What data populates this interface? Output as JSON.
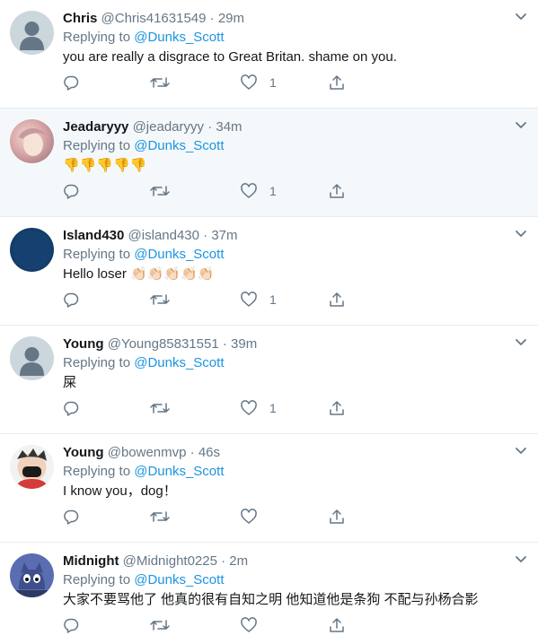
{
  "tweets": [
    {
      "name": "Chris",
      "handle": "@Chris41631549",
      "separator": "·",
      "time": "29m",
      "replying_prefix": "Replying to",
      "mention": "@Dunks_Scott",
      "text": "you are really a disgrace to Great  Britan. shame on you.",
      "like_count": "1",
      "avatar": "default-avatar-icon"
    },
    {
      "name": "Jeadaryyy",
      "handle": "@jeadaryyy",
      "separator": "·",
      "time": "34m",
      "replying_prefix": "Replying to",
      "mention": "@Dunks_Scott",
      "text": "👎👎👎👎👎",
      "like_count": "1",
      "avatar": "photo-avatar"
    },
    {
      "name": "Island430",
      "handle": "@island430",
      "separator": "·",
      "time": "37m",
      "replying_prefix": "Replying to",
      "mention": "@Dunks_Scott",
      "text": "Hello loser 👏🏻👏🏻👏🏻👏🏻👏🏻",
      "like_count": "1",
      "avatar": "dark-blue-avatar"
    },
    {
      "name": "Young",
      "handle": "@Young85831551",
      "separator": "·",
      "time": "39m",
      "replying_prefix": "Replying to",
      "mention": "@Dunks_Scott",
      "text": "屎",
      "like_count": "1",
      "avatar": "default-avatar-icon"
    },
    {
      "name": "Young",
      "handle": "@bowenmvp",
      "separator": "·",
      "time": "46s",
      "replying_prefix": "Replying to",
      "mention": "@Dunks_Scott",
      "text": "I know you，dog！",
      "like_count": "",
      "avatar": "cartoon-avatar"
    },
    {
      "name": "Midnight",
      "handle": "@Midnight0225",
      "separator": "·",
      "time": "2m",
      "replying_prefix": "Replying to",
      "mention": "@Dunks_Scott",
      "text": "大家不要骂他了 他真的很有自知之明 他知道他是条狗 不配与孙杨合影",
      "like_count": "",
      "avatar": "cartoon-cat-avatar"
    }
  ],
  "colors": {
    "link": "#1b95e0",
    "muted": "#657786",
    "text": "#14171a",
    "divider": "#e6ecf0",
    "shaded_row": "#f5f8fa"
  },
  "icons": [
    "reply-icon",
    "retweet-icon",
    "like-icon",
    "share-icon",
    "caret-down-icon"
  ]
}
